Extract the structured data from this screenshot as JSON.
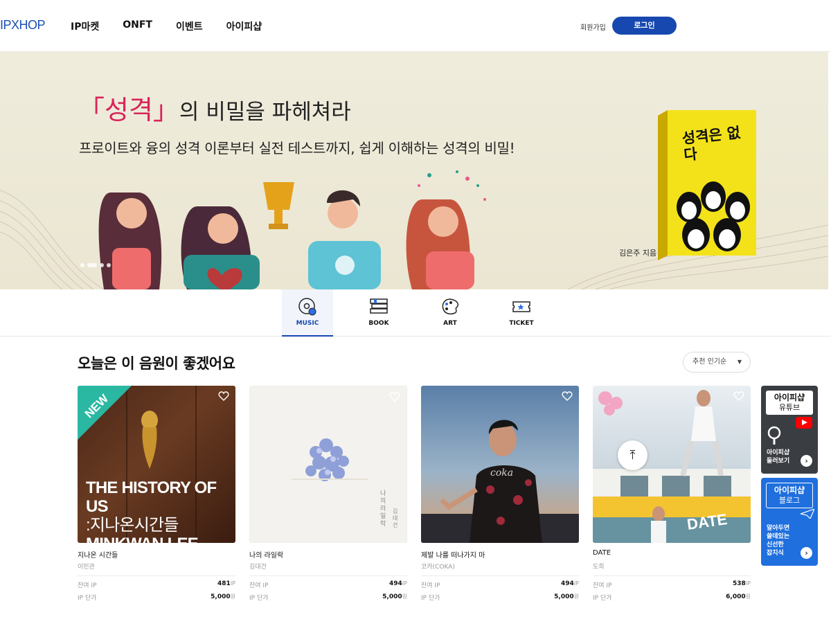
{
  "header": {
    "logo": "IPXHOP",
    "nav": [
      "IP마켓",
      "ONFT",
      "이벤트",
      "아이피샵"
    ],
    "signup": "회원가입",
    "login": "로그인"
  },
  "banner": {
    "title_accent": "「성격」",
    "title_rest": "의 비밀을 파헤쳐라",
    "subtitle": "프로이트와 융의 성격 이론부터 실전 테스트까지, 쉽게 이해하는 성격의 비밀!",
    "book_title": "성격은 없다",
    "author": "김은주 지음",
    "slide_count": 4,
    "active_slide": 2
  },
  "categories": [
    {
      "label": "MUSIC",
      "icon": "music-disc-icon",
      "active": true
    },
    {
      "label": "BOOK",
      "icon": "book-stack-icon",
      "active": false
    },
    {
      "label": "ART",
      "icon": "palette-icon",
      "active": false
    },
    {
      "label": "TICKET",
      "icon": "ticket-icon",
      "active": false
    }
  ],
  "section": {
    "title": "오늘은 이 음원이 좋겠어요",
    "sort_label": "추천 인기순"
  },
  "cards": [
    {
      "name": "지나온 시간들",
      "artist": "이민관",
      "remain_label": "잔여 IP",
      "remain": "481",
      "remain_unit": "IP",
      "price_label": "IP 단가",
      "price": "5,000",
      "price_unit": "원",
      "badge": "NEW",
      "cover_text": [
        "THE HISTORY OF US",
        ":지나온시간들",
        "MINKWAN LEE"
      ]
    },
    {
      "name": "나의 라일락",
      "artist": "김대건",
      "remain_label": "잔여 IP",
      "remain": "494",
      "remain_unit": "IP",
      "price_label": "IP 단가",
      "price": "5,000",
      "price_unit": "원",
      "cover_text": [
        "나의 라일락",
        "김대건"
      ]
    },
    {
      "name": "제발 나를 떠나가지 마",
      "artist": "코카(COKA)",
      "remain_label": "잔여 IP",
      "remain": "494",
      "remain_unit": "IP",
      "price_label": "IP 단가",
      "price": "5,000",
      "price_unit": "원",
      "cover_text": [
        "coka"
      ]
    },
    {
      "name": "DATE",
      "artist": "도희",
      "remain_label": "잔여 IP",
      "remain": "538",
      "remain_unit": "IP",
      "price_label": "IP 단가",
      "price": "6,000",
      "price_unit": "원",
      "cover_text": [
        "DATE"
      ]
    }
  ],
  "side": {
    "youtube": {
      "title": "아이피샵",
      "subtitle": "유튜브",
      "body": [
        "아이피샵",
        "둘러보기"
      ]
    },
    "blog": {
      "title": "아이피샵",
      "subtitle": "블로그",
      "body": [
        "알아두면",
        "쓸데있는",
        "신선한",
        "잡지식"
      ]
    }
  }
}
